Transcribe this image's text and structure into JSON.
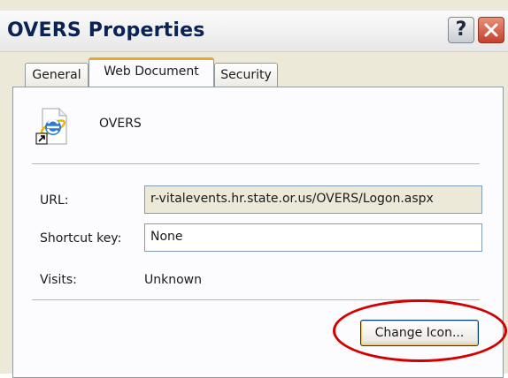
{
  "window": {
    "title": "OVERS Properties",
    "help_label": "?",
    "close_icon": "close-icon"
  },
  "tabs": [
    {
      "label": "General",
      "active": false
    },
    {
      "label": "Web Document",
      "active": true
    },
    {
      "label": "Security",
      "active": false
    }
  ],
  "shortcut": {
    "name": "OVERS",
    "icon": "internet-explorer-shortcut-icon"
  },
  "fields": {
    "url_label": "URL:",
    "url_value": "r-vitalevents.hr.state.or.us/OVERS/Logon.aspx",
    "shortcut_key_label": "Shortcut key:",
    "shortcut_key_value": "None",
    "visits_label": "Visits:",
    "visits_value": "Unknown"
  },
  "buttons": {
    "change_icon_label": "Change Icon..."
  },
  "colors": {
    "annotation": "#d40000",
    "active_tab_accent": "#e6a833"
  }
}
